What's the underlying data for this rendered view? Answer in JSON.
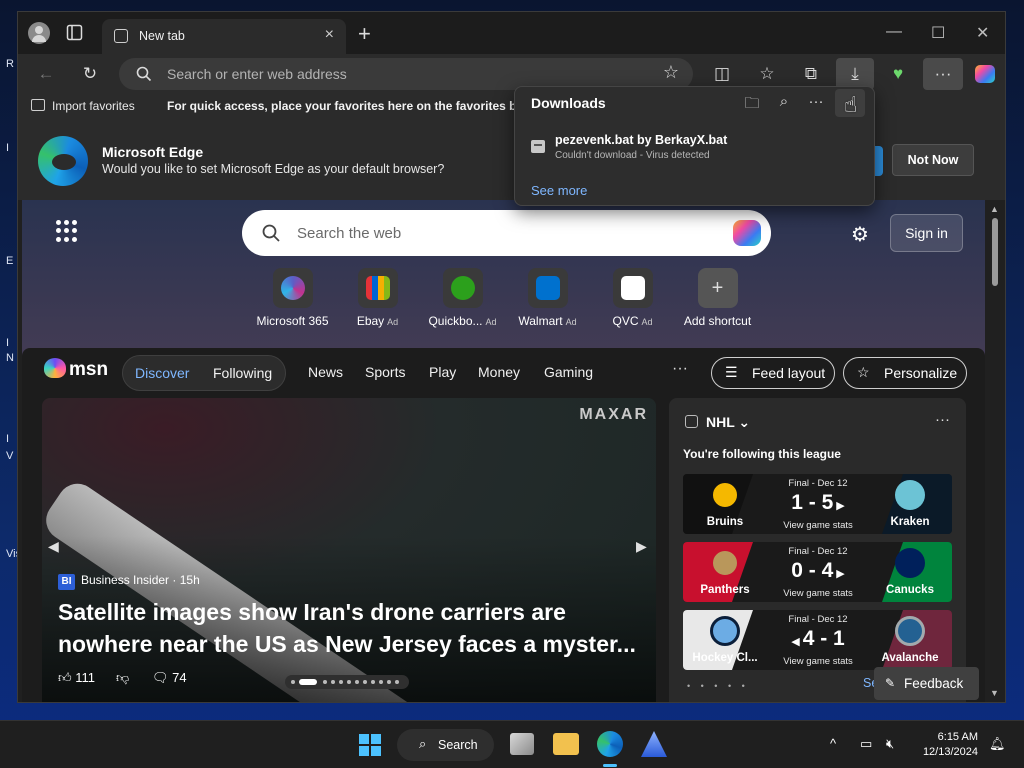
{
  "desktop": {
    "fragments": [
      "R",
      "I",
      "E",
      "I",
      "N",
      "I",
      "V",
      "Vis"
    ]
  },
  "browser": {
    "tab": {
      "title": "New tab"
    },
    "address_bar": {
      "placeholder": "Search or enter web address"
    },
    "favorites_bar": {
      "import_label": "Import favorites",
      "hint": "For quick access, place your favorites here on the favorites bar."
    },
    "banner": {
      "title": "Microsoft Edge",
      "subtitle": "Would you like to set Microsoft Edge as your default browser?",
      "not_now": "Not Now"
    },
    "downloads": {
      "title": "Downloads",
      "file_name": "pezevenk.bat by BerkayX.bat",
      "status": "Couldn't download - Virus detected",
      "see_more": "See more"
    }
  },
  "newtab": {
    "search_placeholder": "Search the web",
    "sign_in": "Sign in",
    "shortcuts": [
      {
        "name": "Microsoft 365",
        "ad": "",
        "color": "#5b5fc7"
      },
      {
        "name": "Ebay",
        "ad": "Ad",
        "color": "#e53238"
      },
      {
        "name": "Quickbo...",
        "ad": "Ad",
        "color": "#2ca01c"
      },
      {
        "name": "Walmart",
        "ad": "Ad",
        "color": "#0071ce"
      },
      {
        "name": "QVC",
        "ad": "Ad",
        "color": "#ffffff"
      },
      {
        "name": "Add shortcut",
        "ad": "",
        "color": "#4a4a4a"
      }
    ]
  },
  "feed": {
    "logo": "msn",
    "tabs": {
      "discover": "Discover",
      "following": "Following"
    },
    "nav": [
      "News",
      "Sports",
      "Play",
      "Money",
      "Gaming"
    ],
    "more": "···",
    "feed_layout": "Feed layout",
    "personalize": "Personalize",
    "hero": {
      "watermark": "MAXAR",
      "source": "Business Insider",
      "source_badge": "BI",
      "age": "15h",
      "headline": "Satellite images show Iran's drone carriers are nowhere near the US as New Jersey faces a myster...",
      "likes": "111",
      "comments": "74"
    },
    "nhl": {
      "title": "NHL",
      "subtitle": "You're following this league",
      "games": [
        {
          "left": "Bruins",
          "right": "Kraken",
          "final": "Final - Dec 12",
          "score": "1 - 5",
          "arrow": "right",
          "stats": "View game stats",
          "left_color": "#111111",
          "right_color": "#0b1a28"
        },
        {
          "left": "Panthers",
          "right": "Canucks",
          "final": "Final - Dec 12",
          "score": "0 - 4",
          "arrow": "right",
          "stats": "View game stats",
          "left_color": "#c8102e",
          "right_color": "#00843d"
        },
        {
          "left": "Hockey Cl...",
          "right": "Avalanche",
          "final": "Final - Dec 12",
          "score": "4 - 1",
          "arrow": "left",
          "stats": "View game stats",
          "left_color": "#e8e8e8",
          "right_color": "#6f263d"
        }
      ],
      "see_all": "Se"
    },
    "feedback": "Feedback"
  },
  "taskbar": {
    "search_label": "Search",
    "time": "6:15 AM",
    "date": "12/13/2024"
  }
}
